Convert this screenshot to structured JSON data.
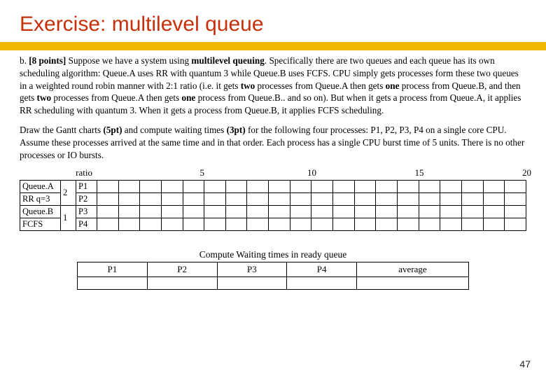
{
  "title": "Exercise: multilevel queue",
  "page_number": "47",
  "problem": {
    "label": "b.",
    "points": "[8 points]",
    "text": "Suppose we have a system using <b>multilevel queuing</b>. Specifically there are two queues and each queue has its own scheduling algorithm: Queue.A uses RR with quantum 3 while Queue.B uses FCFS. CPU simply gets processes form these two queues in a weighted round robin manner  with 2:1 ratio (i.e. it gets <b>two</b> processes from Queue.A then gets <b>one</b> process from Queue.B, and then gets <b>two</b> processes from Queue.A then gets <b>one</b> process from Queue.B.. and so on). But when it gets a process from Queue.A, it applies RR scheduling with quantum 3. When it gets a process from Queue.B, it applies FCFS scheduling."
  },
  "task": {
    "text": "Draw the Gantt charts <b>(5pt)</b> and compute waiting times <b>(3pt)</b> for the following four processes: P1, P2, P3, P4 on a single core CPU. Assume these processes arrived at the same time and in that order. Each process has a single CPU burst time of 5 units. There is no other processes or IO bursts."
  },
  "gantt": {
    "axis_header": "ratio",
    "ticks": [
      "5",
      "10",
      "15",
      "20"
    ],
    "queues": [
      {
        "name": "Queue.A",
        "alg": "RR q=3",
        "ratio": "2",
        "processes": [
          "P1",
          "P2"
        ]
      },
      {
        "name": "Queue.B",
        "alg": "FCFS",
        "ratio": "1",
        "processes": [
          "P3",
          "P4"
        ]
      }
    ],
    "slot_count": 20
  },
  "waiting": {
    "title": "Compute Waiting times in ready queue",
    "headers": [
      "P1",
      "P2",
      "P3",
      "P4",
      "average"
    ],
    "values": [
      "",
      "",
      "",
      "",
      ""
    ]
  }
}
